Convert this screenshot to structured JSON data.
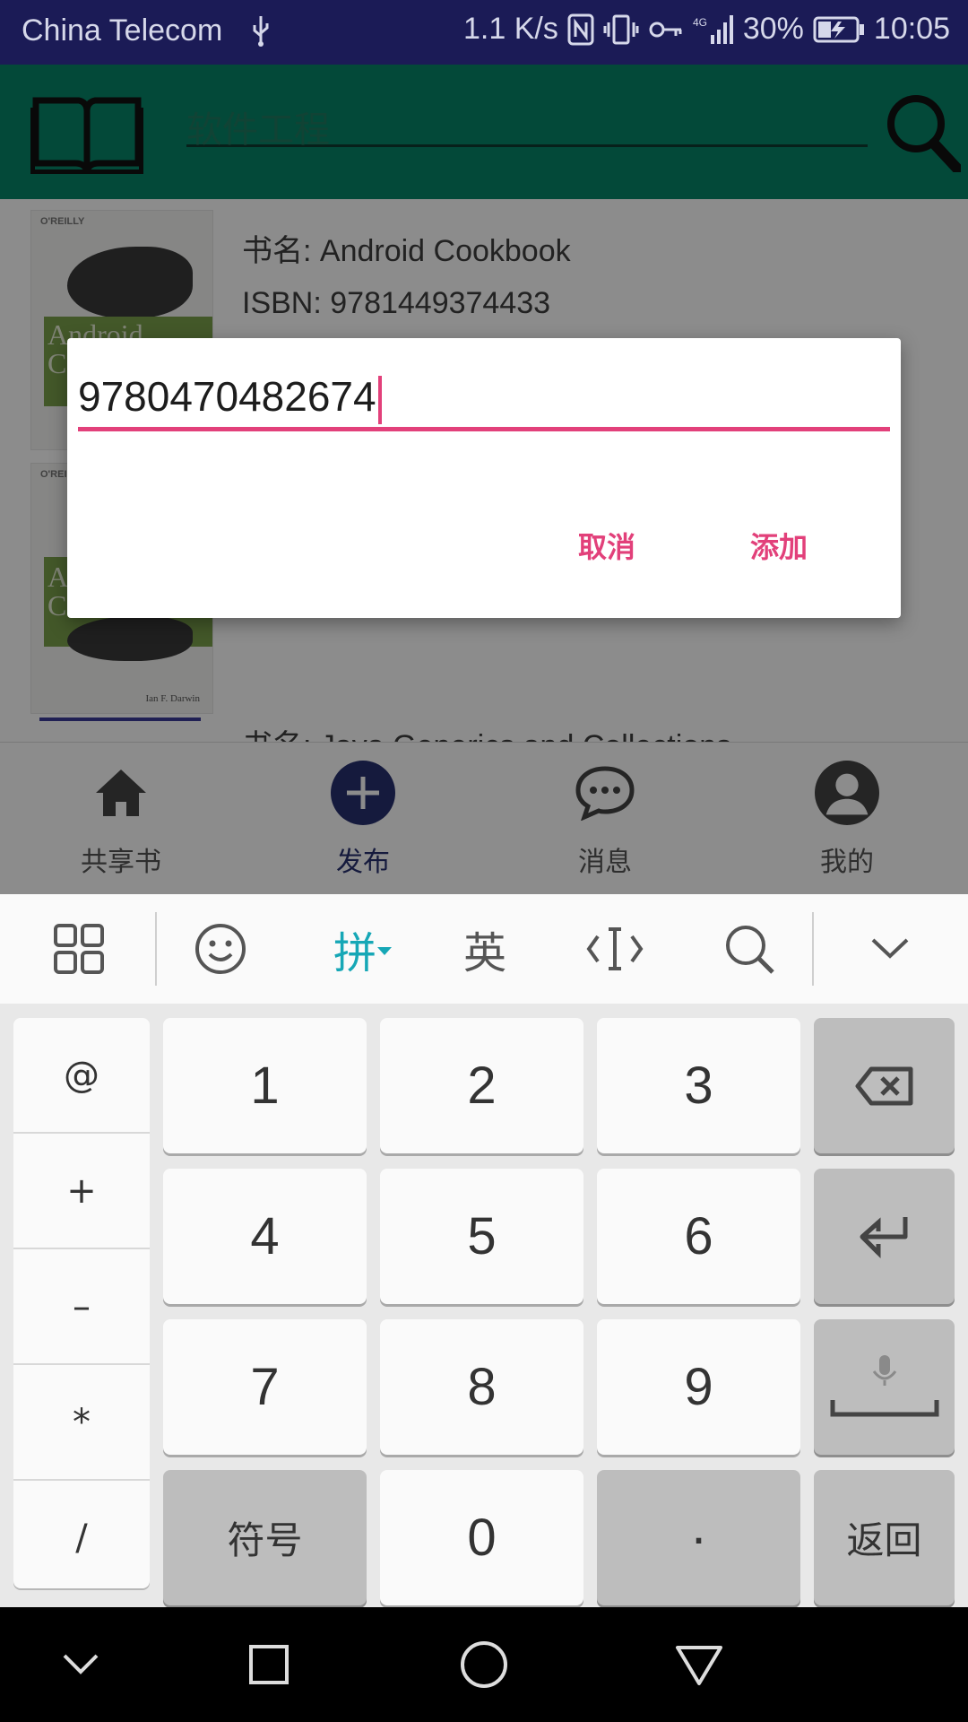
{
  "status_bar": {
    "carrier": "China Telecom",
    "speed": "1.1 K/s",
    "network": "4G",
    "battery": "30%",
    "time": "10:05"
  },
  "header": {
    "search_text": "软件工程"
  },
  "books": [
    {
      "title_line": "书名: Android Cookbook",
      "isbn_line": "ISBN: 9781449374433",
      "cover_publisher": "O'REILLY",
      "cover_title": "Android",
      "cover_letter": "C"
    },
    {
      "cover_publisher": "O'REILLY",
      "cover_title": "A",
      "cover_letter": "C",
      "cover_author": "Ian F. Darwin"
    },
    {
      "title_line": "书名: Java Generics and Collections"
    }
  ],
  "bottom_nav": [
    {
      "label": "共享书",
      "icon": "home-icon"
    },
    {
      "label": "发布",
      "icon": "plus-circle-icon",
      "active": true
    },
    {
      "label": "消息",
      "icon": "chat-icon"
    },
    {
      "label": "我的",
      "icon": "person-icon"
    }
  ],
  "dialog": {
    "input_value": "9780470482674",
    "cancel_label": "取消",
    "add_label": "添加"
  },
  "keyboard": {
    "toolbar": {
      "pinyin_label": "拼",
      "english_label": "英"
    },
    "symbols": [
      "@",
      "+",
      "–",
      "*",
      "/"
    ],
    "digits": [
      "1",
      "2",
      "3",
      "4",
      "5",
      "6",
      "7",
      "8",
      "9",
      "0"
    ],
    "symbol_key_label": "符号",
    "dot_label": "·",
    "return_label": "返回"
  },
  "colors": {
    "status_bar": "#1b1b56",
    "header": "#078668",
    "accent": "#e2407a",
    "nav_active": "#27306f",
    "ime_active": "#16a7b6"
  }
}
